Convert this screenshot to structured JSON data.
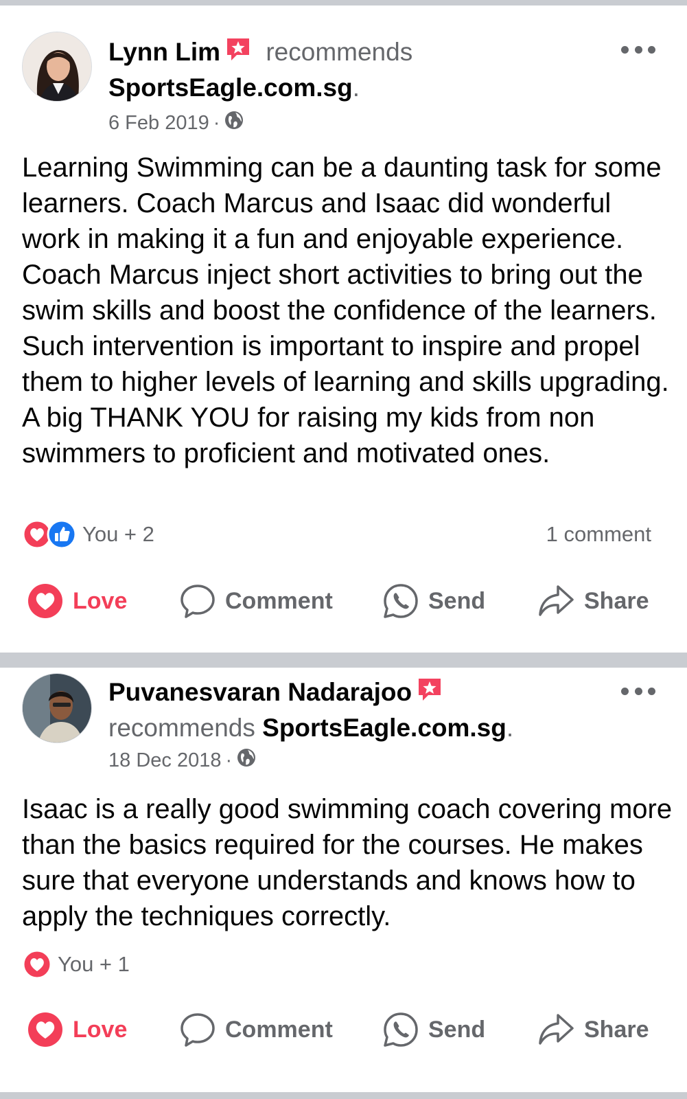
{
  "posts": [
    {
      "author": "Lynn Lim",
      "verb": "recommends",
      "page": "SportsEagle.com.sg",
      "period": ".",
      "date": "6 Feb 2019",
      "date_sep": "·",
      "body": "Learning Swimming can be a daunting task for some learners. Coach Marcus and Isaac did wonderful work in making it a fun and enjoyable experience. Coach Marcus inject short activities to bring out the swim skills and boost the confidence of the learners. Such intervention is important to inspire and propel them to higher levels of learning and skills upgrading. A big THANK YOU for raising my kids from non swimmers to proficient and motivated ones.",
      "reaction_summary": "You + 2",
      "reaction_icons": [
        "love-icon",
        "like-icon"
      ],
      "comment_count": "1 comment"
    },
    {
      "author": "Puvanesvaran Nadarajoo",
      "verb": "recommends",
      "page": "SportsEagle.com.sg",
      "period": ".",
      "date": "18 Dec 2018",
      "date_sep": "·",
      "body": "Isaac is a really good swimming coach covering more than the basics required for the courses. He makes sure that everyone understands and knows how to apply the techniques correctly.",
      "reaction_summary": "You + 1",
      "reaction_icons": [
        "love-icon"
      ]
    }
  ],
  "actions": {
    "love": "Love",
    "comment": "Comment",
    "send": "Send",
    "share": "Share"
  },
  "colors": {
    "love_red": "#f33e58",
    "like_blue": "#1877f2",
    "muted_text": "#65676b",
    "divider": "#c9ccd1",
    "badge_red": "#f3425f"
  }
}
